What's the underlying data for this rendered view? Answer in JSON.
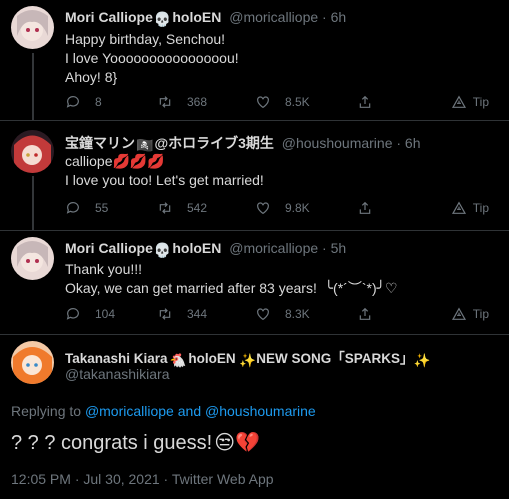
{
  "tweets": [
    {
      "name": "Mori Calliope",
      "name_suffix": "holoEN",
      "handle": "@moricalliope · 6h",
      "lines": [
        "Happy birthday, Senchou!",
        "I love Yooooooooooooooou!",
        "Ahoy! 8}"
      ],
      "replies": "8",
      "retweets": "368",
      "likes": "8.5K",
      "tip": "Tip"
    },
    {
      "name": "宝鐘マリン",
      "name_suffix": "@ホロライブ3期生",
      "handle": "@houshoumarine · 6h",
      "lines": [
        "calliope",
        "I love you too! Let's get married!"
      ],
      "replies": "55",
      "retweets": "542",
      "likes": "9.8K",
      "tip": "Tip"
    },
    {
      "name": "Mori Calliope",
      "name_suffix": "holoEN",
      "handle": "@moricalliope · 5h",
      "lines": [
        "Thank you!!!",
        "Okay, we can get married after 83 years!  ╰(*´︶`*)╯♡"
      ],
      "replies": "104",
      "retweets": "344",
      "likes": "8.3K",
      "tip": "Tip"
    }
  ],
  "main": {
    "name": "Takanashi Kiara",
    "name_suffix": "holoEN",
    "name_extra": "NEW SONG「SPARKS」",
    "handle": "@takanashikiara",
    "replying_prefix": "Replying to ",
    "replying_to_1": "@moricalliope",
    "replying_and": " and ",
    "replying_to_2": "@houshoumarine",
    "text": "? ? ? congrats i guess!",
    "meta": "12:05 PM · Jul 30, 2021 · Twitter Web App"
  },
  "colors": {
    "background": "#000000",
    "link": "#1d9bf0",
    "muted": "#6e767d"
  }
}
